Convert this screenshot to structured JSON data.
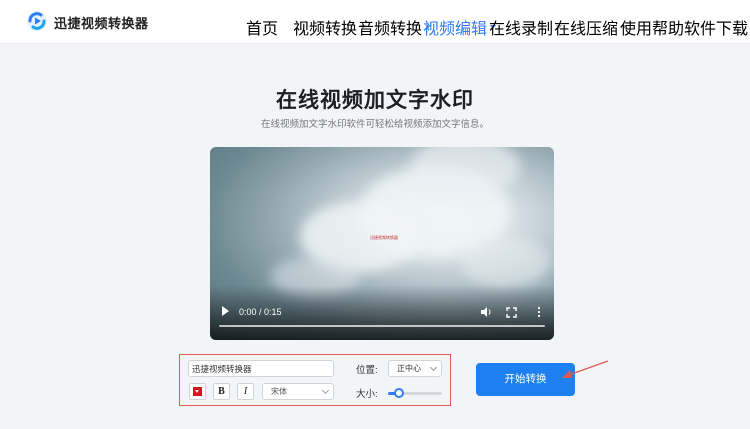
{
  "header": {
    "brand": "迅捷视频转换器",
    "nav": [
      {
        "label": "首页",
        "dropdown": false,
        "active": false
      },
      {
        "label": "视频转换",
        "dropdown": true,
        "active": false
      },
      {
        "label": "音频转换",
        "dropdown": true,
        "active": false
      },
      {
        "label": "视频编辑",
        "dropdown": true,
        "active": true
      },
      {
        "label": "在线录制",
        "dropdown": true,
        "active": false
      },
      {
        "label": "在线压缩",
        "dropdown": true,
        "active": false
      },
      {
        "label": "使用帮助",
        "dropdown": false,
        "active": false
      },
      {
        "label": "软件下载",
        "dropdown": false,
        "active": false
      }
    ]
  },
  "page": {
    "title": "在线视频加文字水印",
    "subtitle": "在线视频加文字水印软件可轻松给视频添加文字信息。"
  },
  "video": {
    "time": "0:00 / 0:15",
    "progress": 0
  },
  "watermark": {
    "text_value": "迅捷视频转换器",
    "color": "#d8141c",
    "bold_label": "B",
    "italic_label": "I",
    "font": "宋体",
    "position_label": "位置:",
    "position_value": "正中心",
    "size_label": "大小:",
    "size_level": 0.2
  },
  "actions": {
    "start_label": "开始转换"
  },
  "colors": {
    "accent": "#2f7cf6",
    "button": "#1e7ff0",
    "highlight_border": "#e05a4e"
  }
}
